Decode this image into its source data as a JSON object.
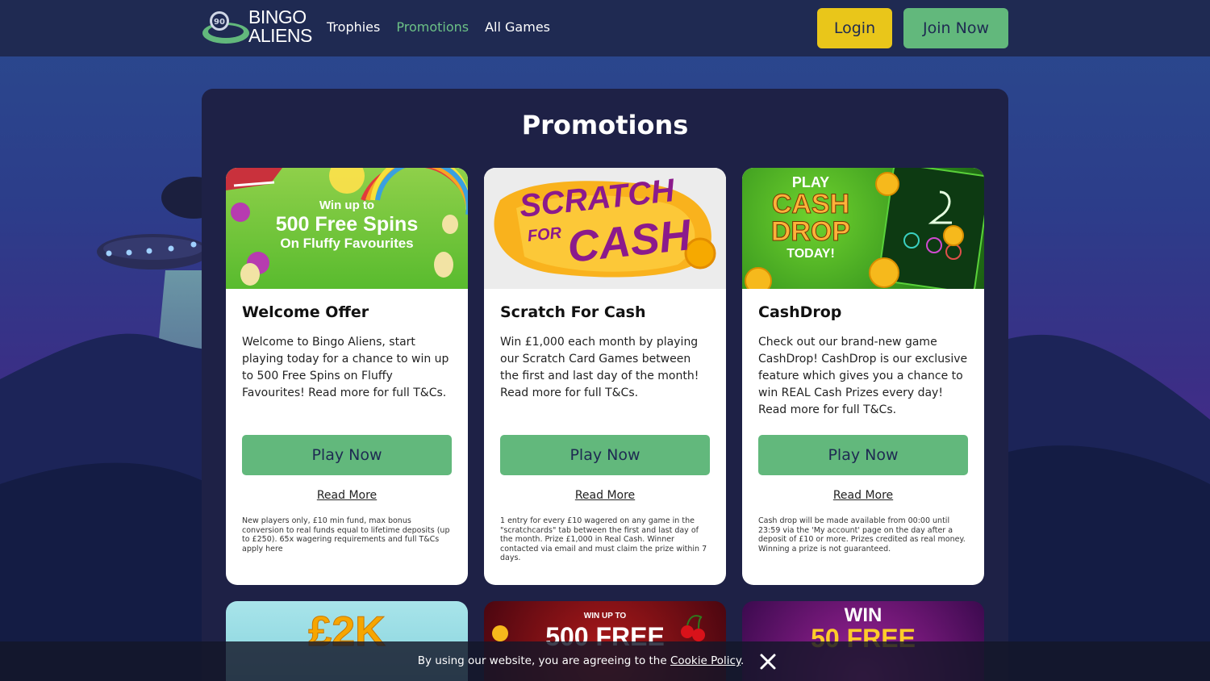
{
  "header": {
    "logo_line1": "BINGO",
    "logo_line2": "ALIENS",
    "logo_badge": "90",
    "nav": [
      {
        "label": "Trophies",
        "active": false
      },
      {
        "label": "Promotions",
        "active": true
      },
      {
        "label": "All Games",
        "active": false
      }
    ],
    "login_label": "Login",
    "join_label": "Join Now"
  },
  "main": {
    "title": "Promotions",
    "cards": [
      {
        "banner_line1": "Win up to",
        "banner_line2": "500 Free Spins",
        "banner_line3": "On Fluffy Favourites",
        "title": "Welcome Offer",
        "description": "Welcome to Bingo Aliens, start playing today for a chance to win up to 500 Free Spins on Fluffy Favourites! Read more for full T&Cs.",
        "play_label": "Play Now",
        "read_more_label": "Read More",
        "terms": "New players only, £10 min fund, max bonus conversion to real funds equal to lifetime deposits (up to £250). 65x wagering requirements and full T&Cs apply here"
      },
      {
        "banner_line1": "SCRATCH",
        "banner_line2": "FOR",
        "banner_line3": "CASH",
        "title": "Scratch For Cash",
        "description": "Win £1,000 each month by playing our Scratch Card Games between the first and last day of the month! Read more for full T&Cs.",
        "play_label": "Play Now",
        "read_more_label": "Read More",
        "terms": "1 entry for every £10 wagered on any game in the \"scratchcards\" tab between the first and last day of the month. Prize £1,000 in Real Cash. Winner contacted via email and must claim the prize within 7 days."
      },
      {
        "banner_line1": "PLAY",
        "banner_line2": "CASH",
        "banner_line3": "DROP",
        "banner_line4": "TODAY!",
        "title": "CashDrop",
        "description": "Check out our brand-new game CashDrop! CashDrop is our exclusive feature which gives you a chance to win REAL Cash Prizes every day! Read more for full T&Cs.",
        "play_label": "Play Now",
        "read_more_label": "Read More",
        "terms": "Cash drop will be made available from 00:00 until 23:59 via the 'My account' page on the day after a deposit of £10 or more. Prizes credited as real money. Winning a prize is not guaranteed."
      }
    ],
    "second_row": [
      {
        "banner": "£2K"
      },
      {
        "banner_small": "WIN UP TO",
        "banner": "500 FREE"
      },
      {
        "banner_small": "WIN",
        "banner": "50 FREE"
      }
    ]
  },
  "cookie": {
    "text": "By using our website, you are agreeing to the",
    "link": "Cookie Policy",
    "suffix": "."
  },
  "colors": {
    "header_bg": "#1f2a52",
    "accent_green": "#62b87c",
    "login_yellow": "#e9c61a",
    "panel_bg": "#1e2146"
  }
}
